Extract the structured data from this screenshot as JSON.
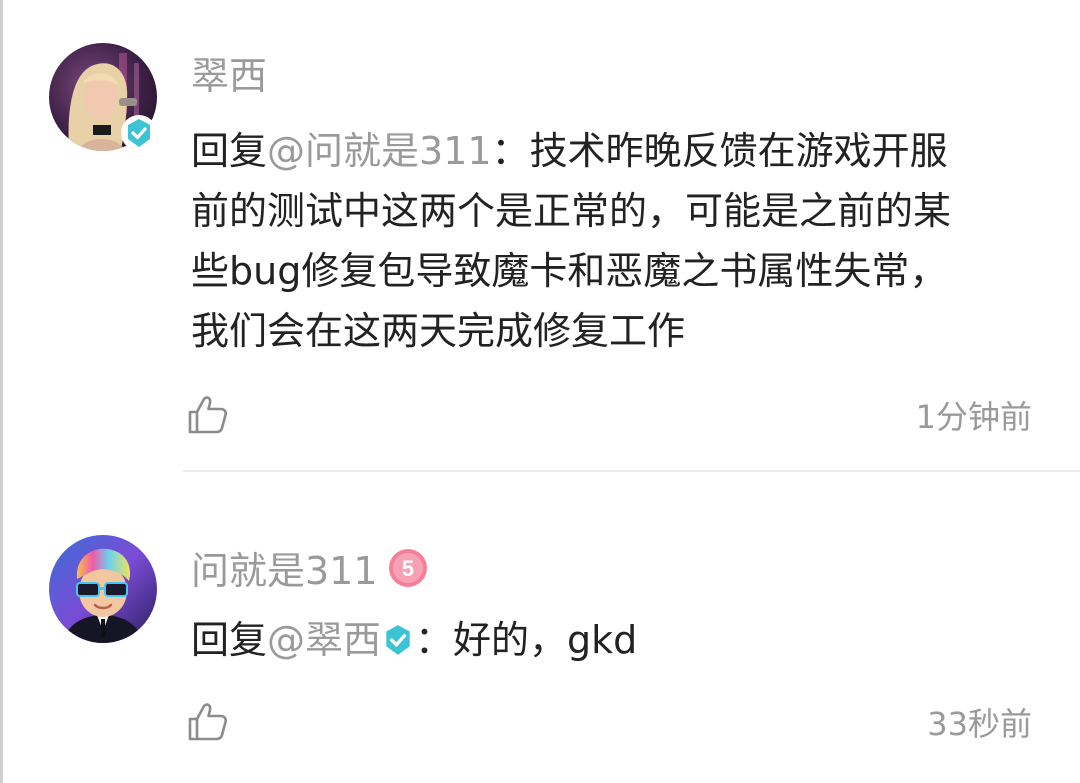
{
  "comments": [
    {
      "username": "翠西",
      "reply_prefix": "回复",
      "mention": "@问就是311",
      "colon": "：",
      "text_line1": "技术昨晚反馈在游戏开服",
      "text_line2": "前的测试中这两个是正常的，可能是之前的某",
      "text_line3": "些bug修复包导致魔卡和恶魔之书属性失常，",
      "text_line4": "我们会在这两天完成修复工作",
      "timestamp": "1分钟前",
      "verified": true,
      "avatar_icon": "avatar-blonde-woman"
    },
    {
      "username": "问就是311",
      "level_badge": "5",
      "reply_prefix": "回复",
      "mention": "@翠西",
      "colon": "：",
      "text": "好的，gkd",
      "timestamp": "33秒前",
      "avatar_icon": "avatar-cartoon-man-sunglasses"
    }
  ],
  "colors": {
    "verify_badge": "#3cc3d4",
    "level_badge": "#f3809a",
    "muted_text": "#9a9a9a",
    "body_text": "#222222"
  },
  "icons": {
    "like": "thumbs-up-icon",
    "verified": "verified-check-icon",
    "level": "level-badge-icon"
  }
}
